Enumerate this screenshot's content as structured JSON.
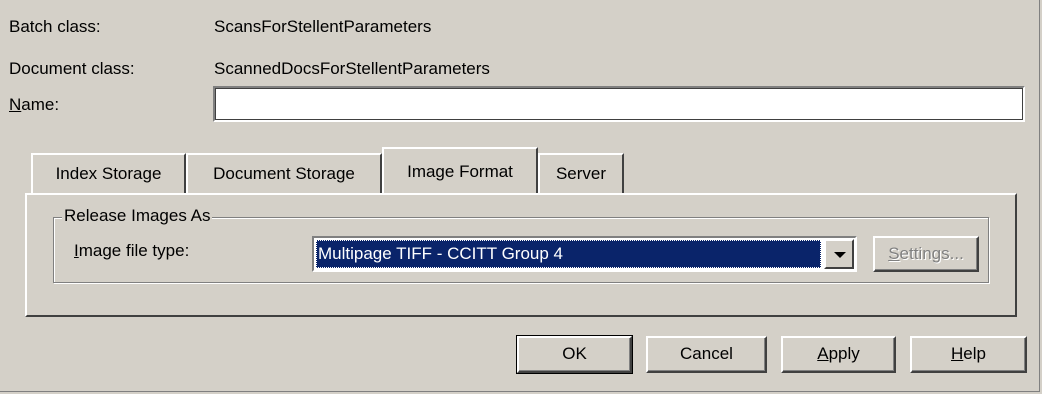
{
  "fields": {
    "batch_class_label": "Batch class:",
    "batch_class_value": "ScansForStellentParameters",
    "document_class_label": "Document class:",
    "document_class_value": "ScannedDocsForStellentParameters",
    "name_label_mnemonic": "N",
    "name_label_rest": "ame:",
    "name_value": ""
  },
  "tabs": [
    {
      "label": "Index Storage",
      "active": false
    },
    {
      "label": "Document Storage",
      "active": false
    },
    {
      "label": "Image Format",
      "active": true
    },
    {
      "label": "Server",
      "active": false
    }
  ],
  "image_format": {
    "group_title": "Release Images As",
    "file_type_label_mnemonic": "I",
    "file_type_label_rest": "mage file type:",
    "file_type_value": "Multipage TIFF - CCITT Group 4",
    "settings_mnemonic": "S",
    "settings_rest": "ettings..."
  },
  "buttons": {
    "ok": "OK",
    "cancel": "Cancel",
    "apply_mnemonic": "A",
    "apply_rest": "pply",
    "help_mnemonic": "H",
    "help_rest": "elp"
  }
}
